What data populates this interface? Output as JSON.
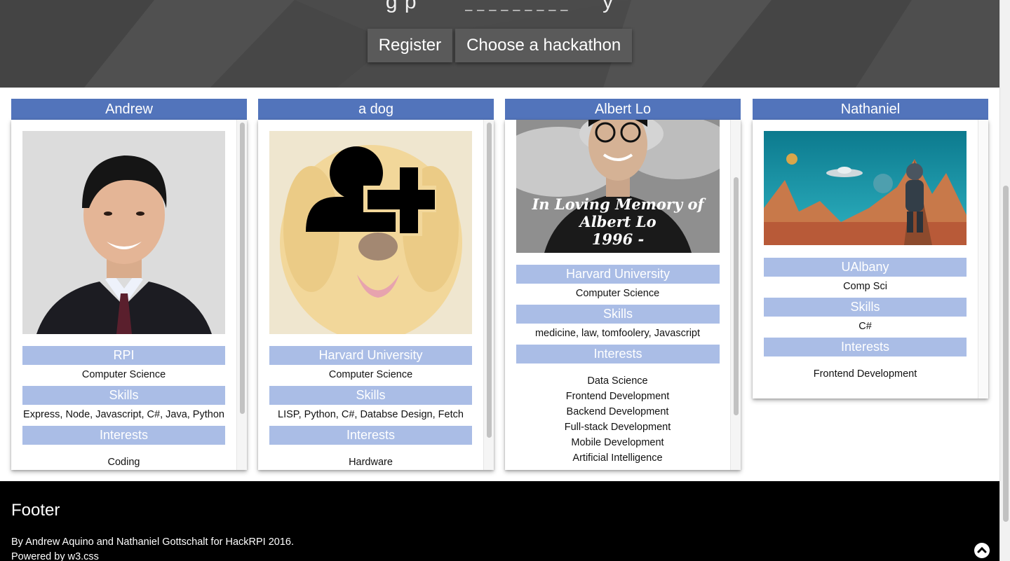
{
  "hero": {
    "tagline_left": "g p",
    "tagline_blank": "_ _ _ _ _ _ _ _ _",
    "tagline_right": "y",
    "register_label": "Register",
    "choose_label": "Choose a hackathon"
  },
  "cards": [
    {
      "name": "Andrew",
      "school": "RPI",
      "major": "Computer Science",
      "skills_label": "Skills",
      "skills": "Express, Node, Javascript, C#, Java, Python",
      "interests_label": "Interests",
      "interests": [
        "Coding"
      ]
    },
    {
      "name": "a dog",
      "school": "Harvard University",
      "major": "Computer Science",
      "skills_label": "Skills",
      "skills": "LISP, Python, C#, Databse Design, Fetch",
      "interests_label": "Interests",
      "interests": [
        "Hardware"
      ]
    },
    {
      "name": "Albert Lo",
      "photo_caption_1": "In Loving Memory of",
      "photo_caption_2": "Albert Lo",
      "photo_caption_3": "1996 -",
      "school": "Harvard University",
      "major": "Computer Science",
      "skills_label": "Skills",
      "skills": "medicine, law, tomfoolery, Javascript",
      "interests_label": "Interests",
      "interests": [
        "Data Science",
        "Frontend Development",
        "Backend Development",
        "Full-stack Development",
        "Mobile Development",
        "Artificial Intelligence"
      ]
    },
    {
      "name": "Nathaniel",
      "school": "UAlbany",
      "major": "Comp Sci",
      "skills_label": "Skills",
      "skills": "C#",
      "interests_label": "Interests",
      "interests": [
        "Frontend Development"
      ]
    }
  ],
  "footer": {
    "title": "Footer",
    "credit": "By Andrew Aquino and Nathaniel Gottschalt for HackRPI 2016.",
    "powered": "Powered by w3.css"
  },
  "icons": {
    "add_user": "add-user-icon",
    "to_top": "chevron-up-icon"
  },
  "colors": {
    "card_header": "#5274bb",
    "label_bar": "#aabde6",
    "hero_bg": "#4a4a4a",
    "footer_bg": "#000000"
  }
}
